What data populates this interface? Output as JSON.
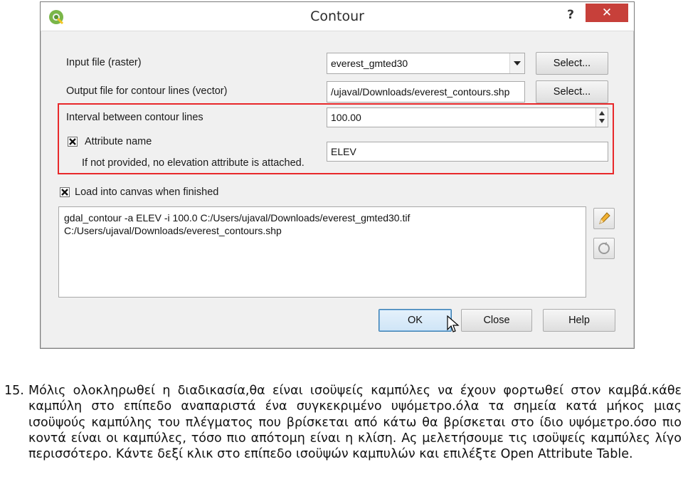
{
  "window": {
    "title": "Contour",
    "help_symbol": "?",
    "close_symbol": "✕"
  },
  "form": {
    "input_file_label": "Input file (raster)",
    "input_file_value": "everest_gmted30",
    "input_select_label": "Select...",
    "output_file_label": "Output file for contour lines (vector)",
    "output_file_value": "/ujaval/Downloads/everest_contours.shp",
    "output_select_label": "Select...",
    "interval_label": "Interval between contour lines",
    "interval_value": "100.00",
    "attribute_name_label": "Attribute name",
    "attribute_name_checked": true,
    "attribute_name_value": "ELEV",
    "attribute_hint": "If not provided, no elevation attribute is attached.",
    "load_canvas_label": "Load into canvas when finished",
    "load_canvas_checked": true
  },
  "command": {
    "line1": "gdal_contour -a ELEV -i 100.0 C:/Users/ujaval/Downloads/everest_gmted30.tif",
    "line2": "C:/Users/ujaval/Downloads/everest_contours.shp"
  },
  "buttons": {
    "ok": "OK",
    "close": "Close",
    "help": "Help"
  },
  "caption": {
    "number": "15.",
    "text": "Μόλις ολοκληρωθεί η διαδικασία,θα είναι ισοϋψείς καμπύλες να έχουν φορτωθεί στον καμβά.κάθε καμπύλη στο επίπεδο αναπαριστά ένα συγκεκριμένο υψόμετρο.όλα τα σημεία κατά μήκος μιας ισοϋψούς καμπύλης του πλέγματος που βρίσκεται από κάτω θα βρίσκεται στο ίδιο υψόμετρο.όσο πιο κοντά είναι οι καμπύλες, τόσο πιο απότομη είναι η κλίση. Ας μελετήσουμε τις ισοϋψείς καμπύλες λίγο περισσότερο. Κάντε δεξί κλικ στο επίπεδο ισοϋψών καμπυλών και επιλέξτε Open Attribute Table."
  },
  "colors": {
    "highlight_frame": "#e8282a",
    "title_close": "#c7403a",
    "ok_border": "#3c7fb1"
  }
}
